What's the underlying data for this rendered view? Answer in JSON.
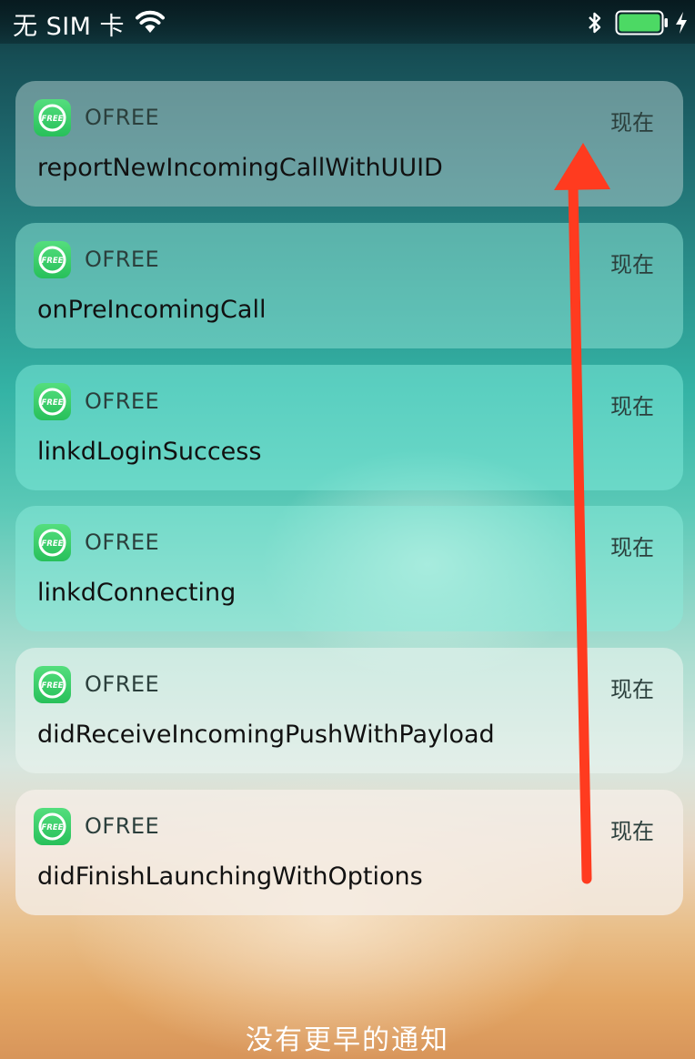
{
  "status_bar": {
    "carrier": "无 SIM 卡",
    "icons": [
      "wifi-icon",
      "bluetooth-icon",
      "battery-icon",
      "charging-bolt-icon"
    ],
    "battery_color": "#4cd964"
  },
  "notifications": [
    {
      "app": "OFREE",
      "time": "现在",
      "message": "reportNewIncomingCallWithUUID"
    },
    {
      "app": "OFREE",
      "time": "现在",
      "message": "onPreIncomingCall"
    },
    {
      "app": "OFREE",
      "time": "现在",
      "message": "linkdLoginSuccess"
    },
    {
      "app": "OFREE",
      "time": "现在",
      "message": "linkdConnecting"
    },
    {
      "app": "OFREE",
      "time": "现在",
      "message": "didReceiveIncomingPushWithPayload"
    },
    {
      "app": "OFREE",
      "time": "现在",
      "message": "didFinishLaunchingWithOptions"
    }
  ],
  "app_icon": {
    "name": "ofree-app-icon",
    "label": "FREE",
    "color": "#34c759"
  },
  "annotation": {
    "name": "arrow-up-icon",
    "color": "#ff3b1f"
  },
  "footer": {
    "no_more_text": "没有更早的通知"
  }
}
